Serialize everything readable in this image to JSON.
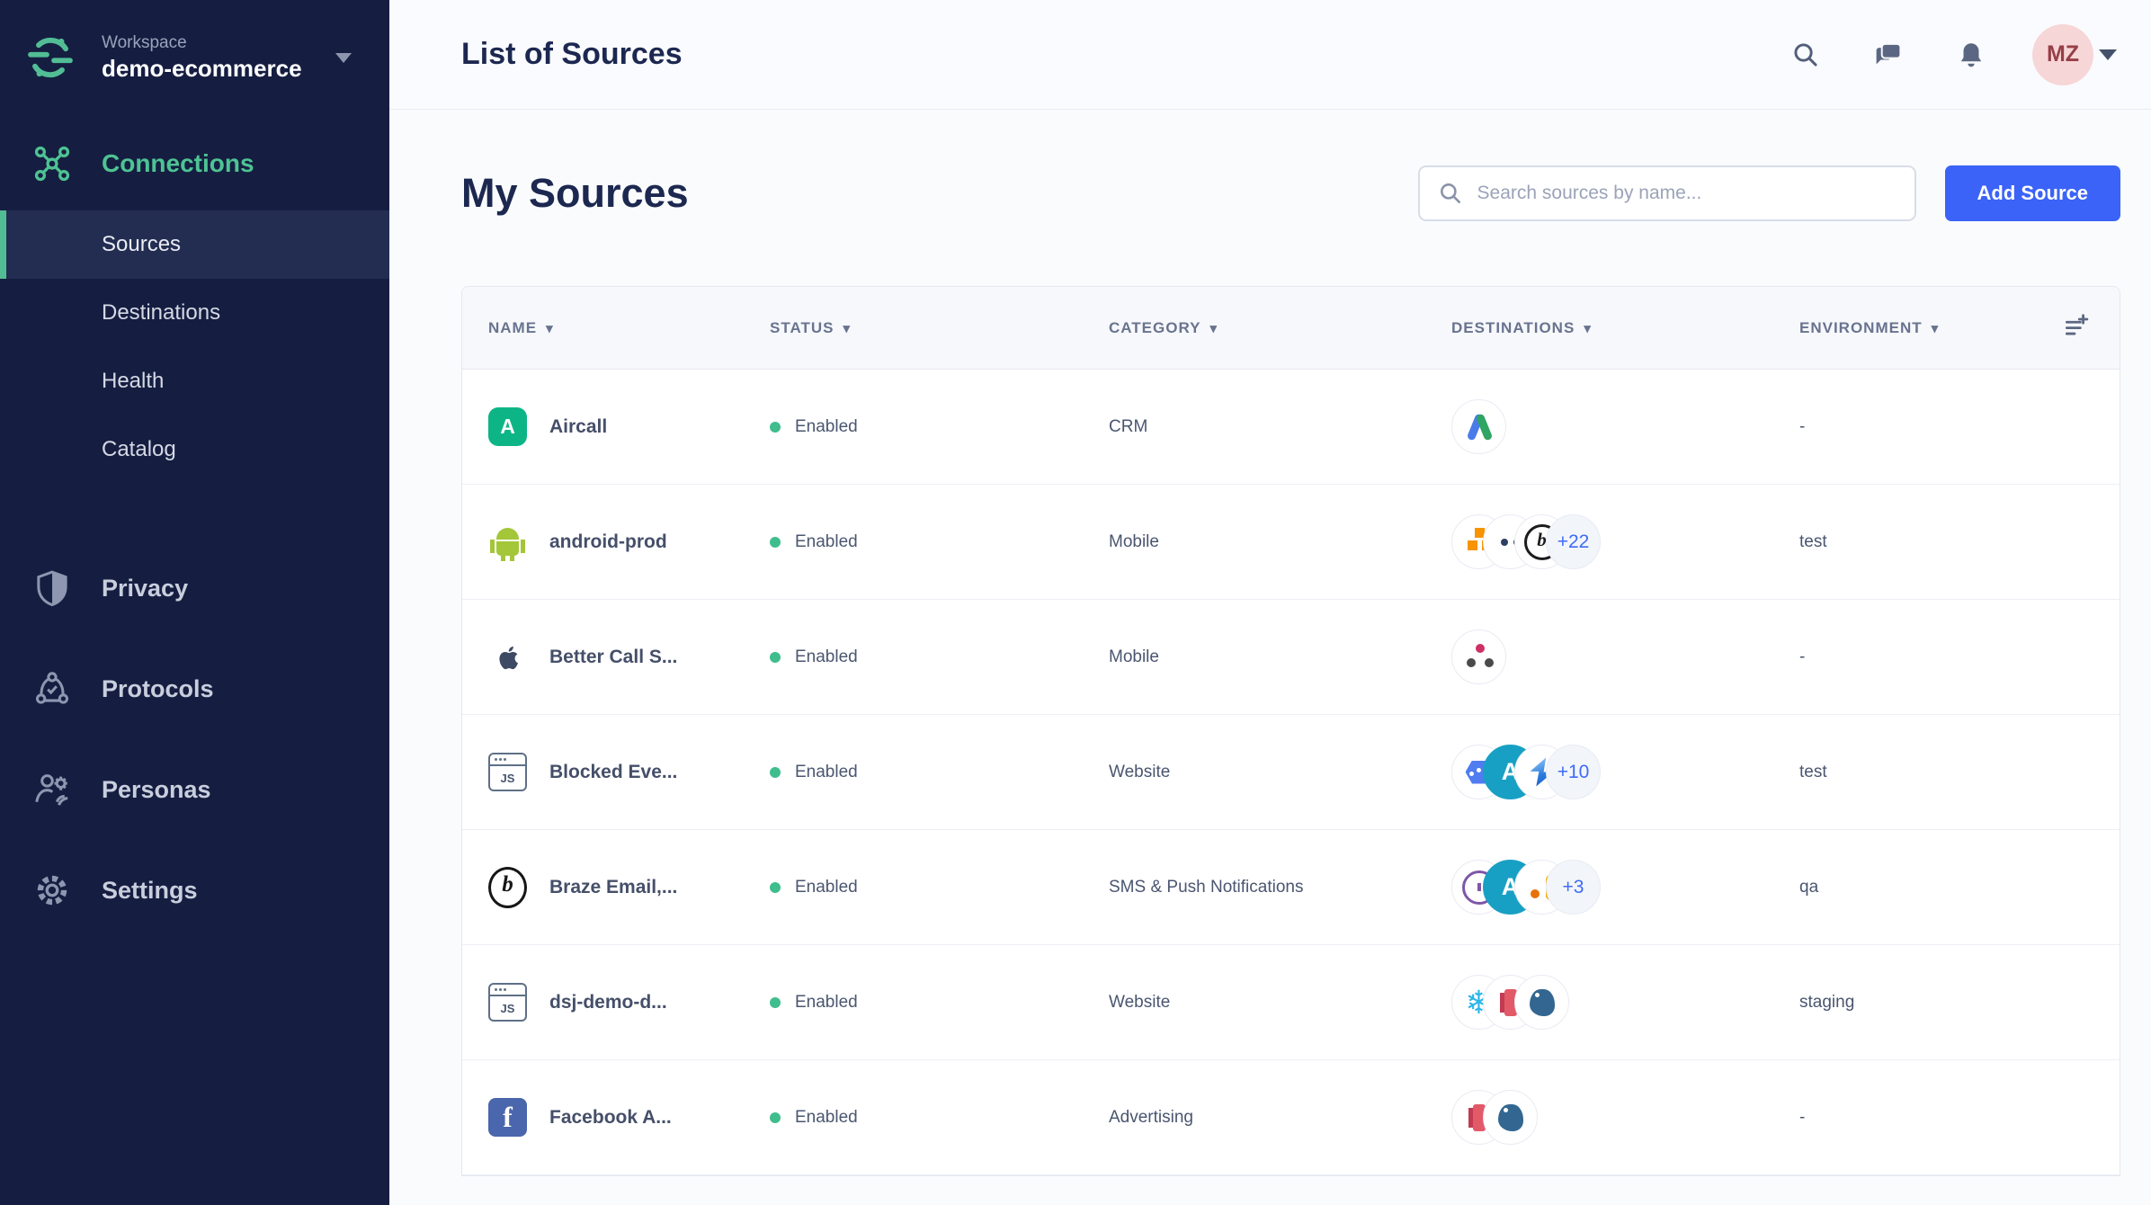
{
  "sidebar": {
    "workspace": {
      "label": "Workspace",
      "name": "demo-ecommerce"
    },
    "connections_label": "Connections",
    "items": [
      {
        "label": "Sources"
      },
      {
        "label": "Destinations"
      },
      {
        "label": "Health"
      },
      {
        "label": "Catalog"
      }
    ],
    "sections": [
      {
        "label": "Privacy"
      },
      {
        "label": "Protocols"
      },
      {
        "label": "Personas"
      },
      {
        "label": "Settings"
      }
    ],
    "accent_color": "#52bd95"
  },
  "topbar": {
    "title": "List of Sources",
    "avatar_initials": "MZ",
    "icons": [
      "search-icon",
      "chat-icon",
      "bell-icon"
    ]
  },
  "toolbar": {
    "heading": "My Sources",
    "search_placeholder": "Search sources by name...",
    "add_button": "Add Source",
    "add_button_color": "#3b63f7"
  },
  "table": {
    "columns": [
      "NAME",
      "STATUS",
      "CATEGORY",
      "DESTINATIONS",
      "ENVIRONMENT"
    ],
    "status_color": "#3fbd8d",
    "rows": [
      {
        "name": "Aircall",
        "icon": "aircall",
        "status": "Enabled",
        "category": "CRM",
        "destinations": [
          "adwords"
        ],
        "more": "",
        "environment": "-"
      },
      {
        "name": "android-prod",
        "icon": "android",
        "status": "Enabled",
        "category": "Mobile",
        "destinations": [
          "aws",
          "dots",
          "braze"
        ],
        "more": "+22",
        "environment": "test"
      },
      {
        "name": "Better Call S...",
        "icon": "apple",
        "status": "Enabled",
        "category": "Mobile",
        "destinations": [
          "webhook"
        ],
        "more": "",
        "environment": "-"
      },
      {
        "name": "Blocked Eve...",
        "icon": "javascript",
        "status": "Enabled",
        "category": "Website",
        "destinations": [
          "gcloud",
          "teal-a",
          "blue-s"
        ],
        "more": "+10",
        "environment": "test"
      },
      {
        "name": "Braze Email,...",
        "icon": "braze",
        "status": "Enabled",
        "category": "SMS & Push Notifications",
        "destinations": [
          "purple-chart",
          "teal-a",
          "analytics"
        ],
        "more": "+3",
        "environment": "qa"
      },
      {
        "name": "dsj-demo-d...",
        "icon": "javascript",
        "status": "Enabled",
        "category": "Website",
        "destinations": [
          "snowflake",
          "redshift",
          "postgres"
        ],
        "more": "",
        "environment": "staging"
      },
      {
        "name": "Facebook A...",
        "icon": "facebook",
        "status": "Enabled",
        "category": "Advertising",
        "destinations": [
          "redshift",
          "postgres"
        ],
        "more": "",
        "environment": "-"
      }
    ]
  }
}
